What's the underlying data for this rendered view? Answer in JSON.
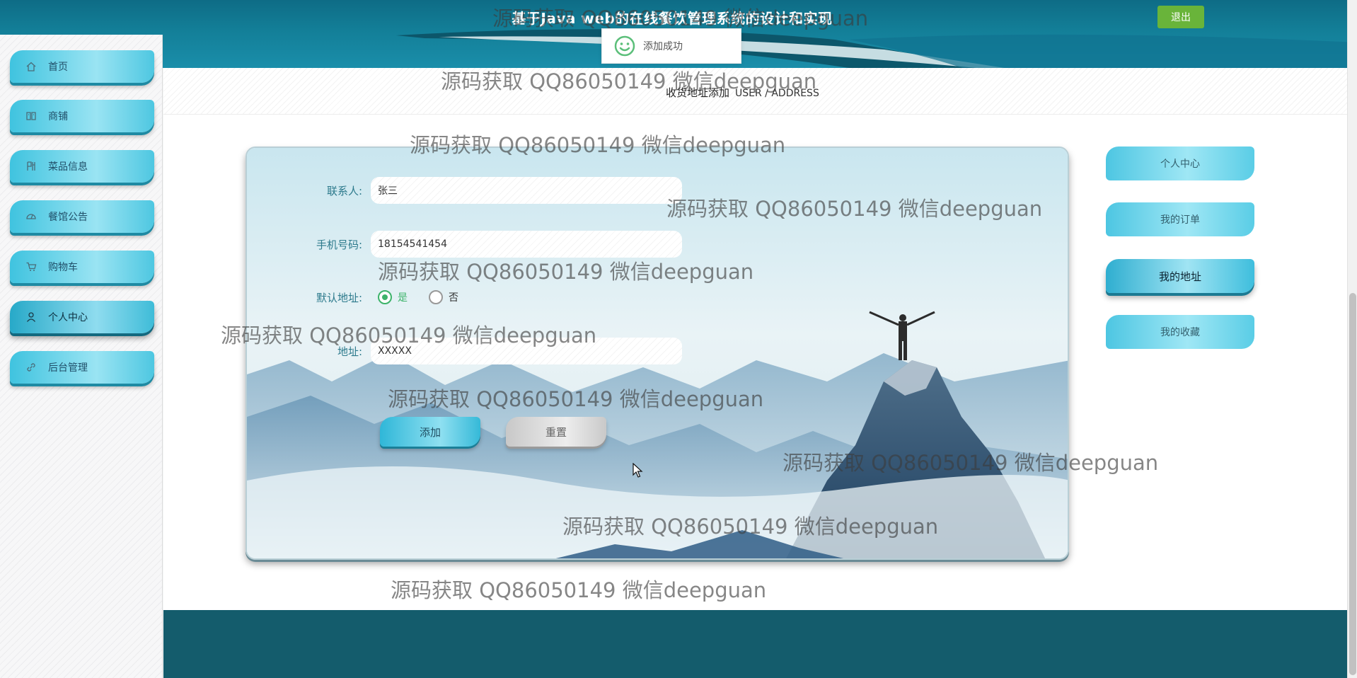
{
  "header": {
    "title": "基于Java web的在线餐饮管理系统的设计和实现",
    "logout_label": "退出"
  },
  "toast": {
    "message": "添加成功",
    "icon": "smile-icon"
  },
  "sidebar": {
    "items": [
      {
        "label": "首页",
        "icon": "home-icon"
      },
      {
        "label": "商铺",
        "icon": "shop-icon"
      },
      {
        "label": "菜品信息",
        "icon": "dish-icon"
      },
      {
        "label": "餐馆公告",
        "icon": "notice-icon"
      },
      {
        "label": "购物车",
        "icon": "cart-icon"
      },
      {
        "label": "个人中心",
        "icon": "user-icon",
        "active": true
      },
      {
        "label": "后台管理",
        "icon": "link-icon"
      }
    ]
  },
  "page": {
    "title": "收货地址添加",
    "title_en": "USER / ADDRESS"
  },
  "form": {
    "contact_label": "联系人:",
    "contact_value": "张三",
    "phone_label": "手机号码:",
    "phone_value": "18154541454",
    "default_label": "默认地址:",
    "default_options": [
      "是",
      "否"
    ],
    "default_selected": "是",
    "address_label": "地址:",
    "address_value": "XXXXX",
    "add_button": "添加",
    "reset_button": "重置"
  },
  "right_nav": {
    "items": [
      {
        "label": "个人中心"
      },
      {
        "label": "我的订单"
      },
      {
        "label": "我的地址",
        "active": true
      },
      {
        "label": "我的收藏"
      }
    ]
  },
  "watermark": {
    "text": "源码获取 QQ86050149 微信deepguan"
  },
  "colors": {
    "header": "#137f98",
    "logout": "#69b43a",
    "nav_gradient": "#3fc3df",
    "footer": "#145c6c",
    "label": "#2d7a8c",
    "radio_checked": "#3db36a"
  }
}
